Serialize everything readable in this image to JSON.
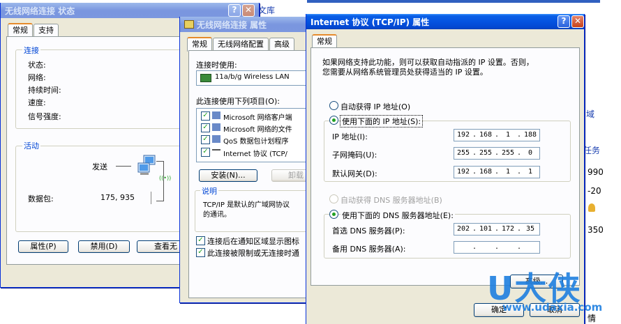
{
  "background": {
    "top_link": "文库",
    "side_link": "域",
    "side_link2": "任务",
    "numbers": [
      "990",
      "-20",
      "350"
    ],
    "bottom_char": "情"
  },
  "status_win": {
    "title": "无线网络连接 状态",
    "tabs": [
      "常规",
      "支持"
    ],
    "connect_group": "连接",
    "fields": [
      "状态:",
      "网络:",
      "持续时间:",
      "速度:",
      "信号强度:"
    ],
    "activity_group": "活动",
    "sent_label": "发送",
    "packets_label": "数据包:",
    "packets_value": "175, 935",
    "buttons": [
      "属性(P)",
      "禁用(D)",
      "查看无"
    ]
  },
  "props_win": {
    "title": "无线网络连接 属性",
    "tabs": [
      "常规",
      "无线网络配置",
      "高级"
    ],
    "connect_using": "连接时使用:",
    "adapter": "11a/b/g Wireless LAN",
    "items_label": "此连接使用下列项目(O):",
    "items": [
      "Microsoft 网络客户端",
      "Microsoft 网络的文件",
      "QoS 数据包计划程序",
      "Internet 协议 (TCP/"
    ],
    "install_btn": "安装(N)...",
    "uninstall_btn": "卸载",
    "desc_group": "说明",
    "desc_line1": "TCP/IP 是默认的广域网协议",
    "desc_line2": "的通讯。",
    "chk1": "连接后在通知区域显示图标",
    "chk2": "此连接被限制或无连接时通"
  },
  "tcpip_win": {
    "title": "Internet 协议 (TCP/IP) 属性",
    "tab": "常规",
    "intro1": "如果网络支持此功能，则可以获取自动指派的 IP 设置。否则，",
    "intro2": "您需要从网络系统管理员处获得适当的 IP 设置。",
    "auto_ip": "自动获得 IP 地址(O)",
    "manual_ip": "使用下面的 IP 地址(S):",
    "ip_label": "IP 地址(I):",
    "ip_value": [
      "192",
      "168",
      "1",
      "188"
    ],
    "mask_label": "子网掩码(U):",
    "mask_value": [
      "255",
      "255",
      "255",
      "0"
    ],
    "gateway_label": "默认网关(D):",
    "gateway_value": [
      "192",
      "168",
      "1",
      "1"
    ],
    "auto_dns": "自动获得 DNS 服务器地址(B)",
    "manual_dns": "使用下面的 DNS 服务器地址(E):",
    "dns1_label": "首选 DNS 服务器(P):",
    "dns1_value": [
      "202",
      "101",
      "172",
      "35"
    ],
    "dns2_label": "备用 DNS 服务器(A):",
    "advanced_btn": "高级...",
    "ok_btn": "确定",
    "cancel_btn": "取消"
  },
  "watermark": {
    "logo": "U大侠",
    "url": "www.udaxia.com"
  }
}
